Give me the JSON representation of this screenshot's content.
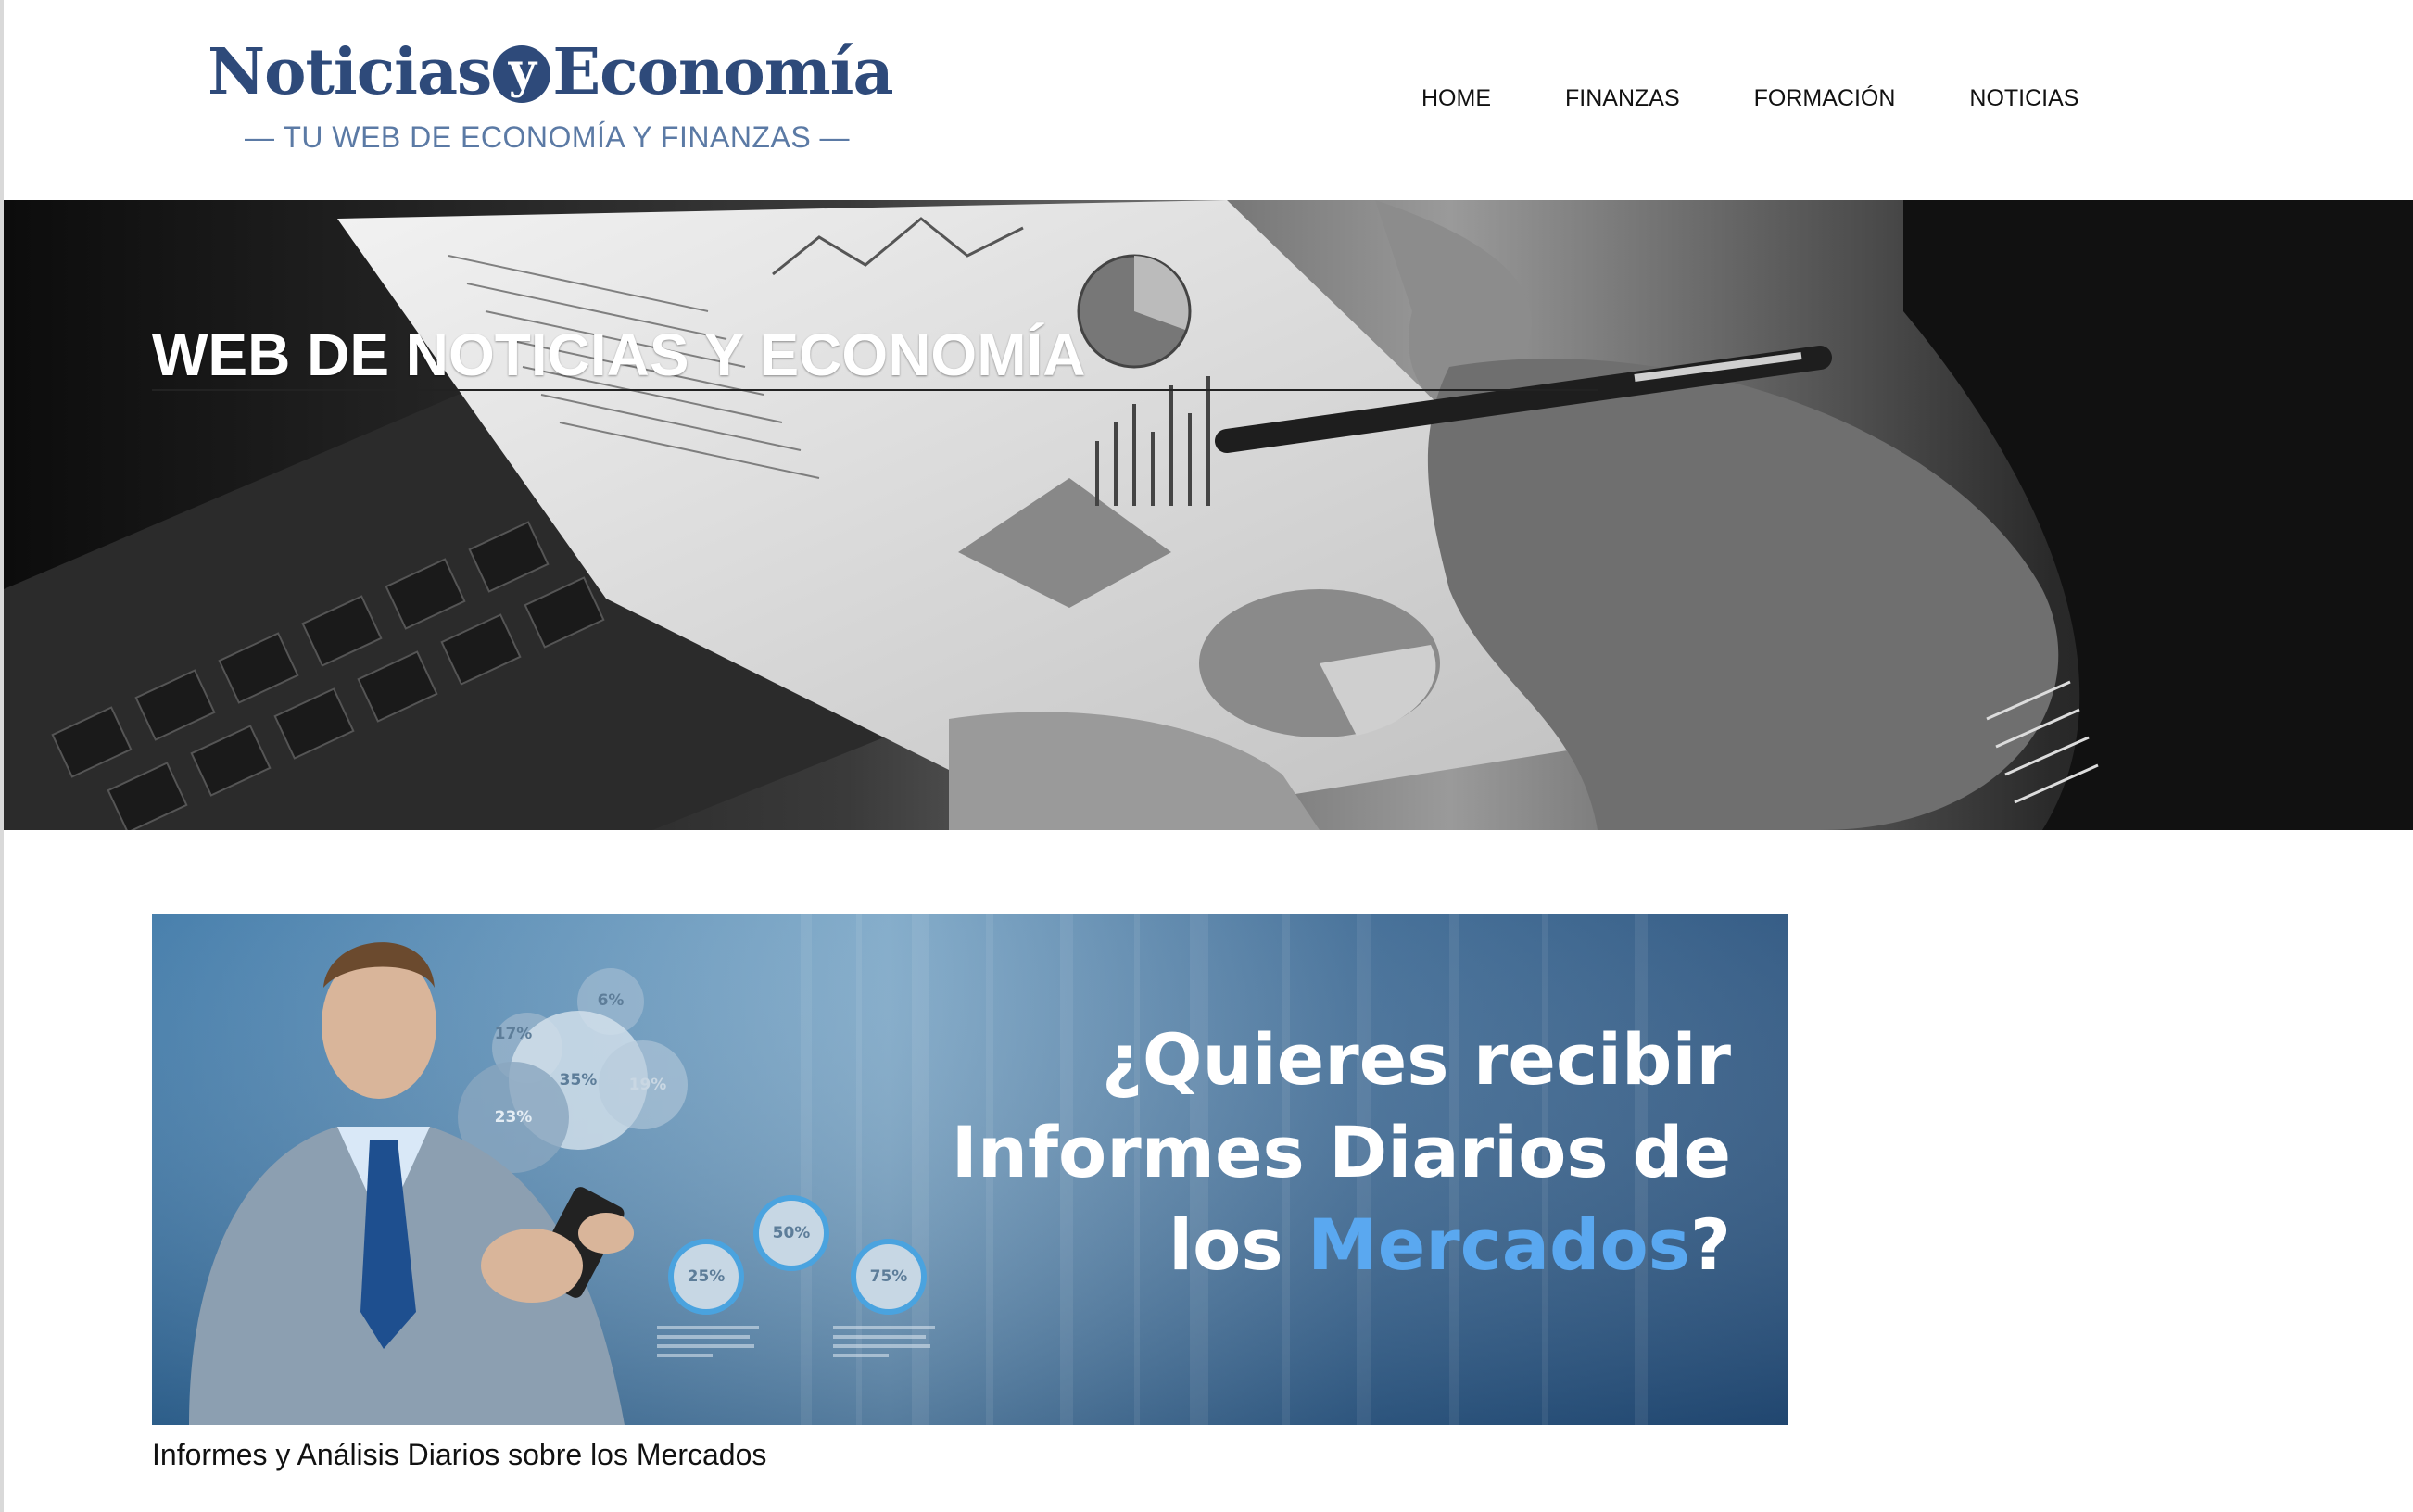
{
  "header": {
    "logo": {
      "word1": "Noticias",
      "y": "y",
      "word2": "Economía",
      "tagline": "— TU WEB DE ECONOMÍA Y FINANZAS —"
    },
    "nav": [
      {
        "label": "HOME"
      },
      {
        "label": "FINANZAS"
      },
      {
        "label": "FORMACIÓN"
      },
      {
        "label": "NOTICIAS"
      }
    ]
  },
  "hero": {
    "title": "WEB DE NOTICIAS Y ECONOMÍA"
  },
  "promo": {
    "line1": "¿Quieres recibir",
    "line2": "Informes Diarios de",
    "line3_pre": "los ",
    "line3_highlight": "Mercados",
    "line3_post": "?",
    "bubbles": [
      "17%",
      "6%",
      "35%",
      "19%",
      "23%",
      "50%",
      "25%",
      "75%"
    ]
  },
  "caption": "Informes y Análisis Diarios sobre los Mercados",
  "colors": {
    "brand_navy": "#2e4a7a",
    "tagline_blue": "#5b7aa5",
    "banner_highlight": "#5aa8f0"
  }
}
